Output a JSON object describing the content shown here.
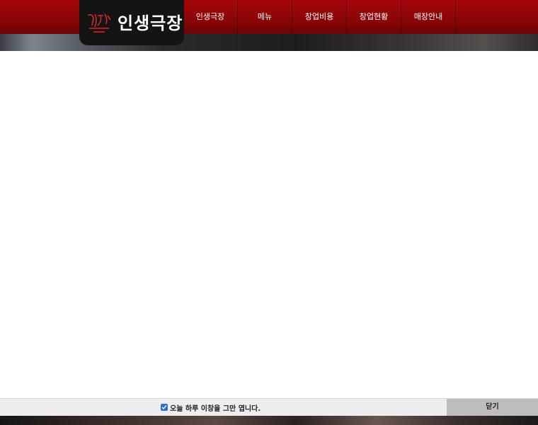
{
  "header": {
    "logo_text": "인생극장",
    "nav_items": [
      "인생극장",
      "메뉴",
      "창업비용",
      "창업현황",
      "매장안내"
    ]
  },
  "popup": {
    "dismiss_checked": true,
    "dismiss_label": "오늘 하루 이창을 그만 엽니다.",
    "close_label": "닫기"
  },
  "colors": {
    "header_red": "#8c0508",
    "logo_bg": "#141414",
    "checkbox_blue": "#2d6fcf"
  }
}
